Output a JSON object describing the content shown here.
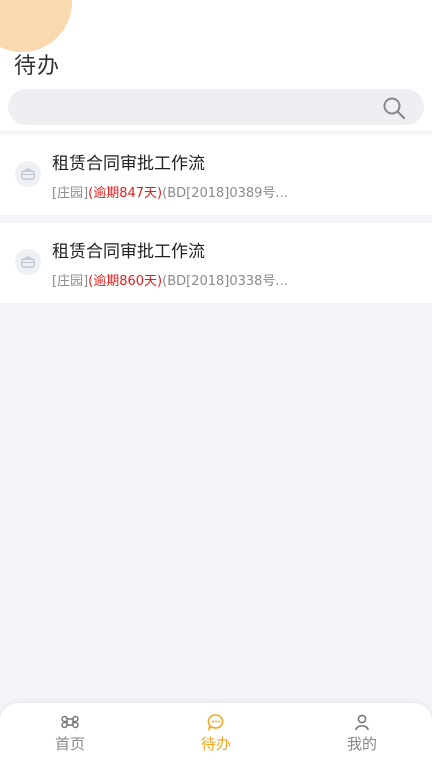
{
  "header": {
    "title": "待办"
  },
  "search": {
    "placeholder": ""
  },
  "tasks": [
    {
      "title": "租赁合同审批工作流",
      "tag": "[庄园]",
      "overdue": "(逾期847天)",
      "ref": "(BD[2018]0389号..."
    },
    {
      "title": "租赁合同审批工作流",
      "tag": "[庄园]",
      "overdue": "(逾期860天)",
      "ref": "(BD[2018]0338号..."
    }
  ],
  "tabbar": {
    "items": [
      {
        "label": "首页",
        "icon": "command-icon"
      },
      {
        "label": "待办",
        "icon": "chat-icon",
        "active": true
      },
      {
        "label": "我的",
        "icon": "user-icon"
      }
    ]
  },
  "colors": {
    "accent": "#f5a623",
    "overdue": "#e02020",
    "decor": "#fbd9b0"
  }
}
